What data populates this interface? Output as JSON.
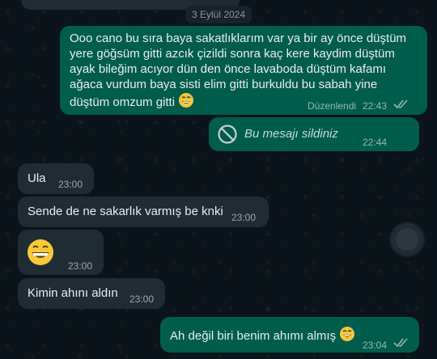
{
  "chat": {
    "date_separator": "3 Eylül 2024",
    "messages": [
      {
        "direction": "outgoing",
        "text": "Ooo cano bu sıra baya sakatlıklarım var ya bir ay önce düştüm yere göğsüm gitti azcık çizildi sonra kaç kere kaydim düştüm ayak bileğim acıyor  dün den önce lavaboda düştüm  kafamı ağaca vurdum baya sisti elim gitti burkuldu bu sabah yine düştüm omzum gitti",
        "edited_label": "Düzenlendi",
        "time": "22:43",
        "status": "read"
      },
      {
        "direction": "outgoing",
        "deleted_text": "Bu mesajı sildiniz",
        "time": "22:44"
      },
      {
        "direction": "incoming",
        "text": "Ula",
        "time": "23:00"
      },
      {
        "direction": "incoming",
        "text": "Sende de ne sakarlık varmış be knki",
        "time": "23:00"
      },
      {
        "direction": "incoming",
        "emoji": "grinning-face-emoji",
        "time": "23:00"
      },
      {
        "direction": "incoming",
        "text": "Kimin ahını aldın",
        "time": "23:00"
      },
      {
        "direction": "outgoing",
        "text": "Ah değil biri benim ahımı almış",
        "time": "23:04",
        "status": "read"
      }
    ]
  },
  "colors": {
    "background": "#0b141a",
    "outgoing_bubble": "#005c4b",
    "incoming_bubble": "#202c33",
    "text": "#e9edef",
    "meta": "#8696a0"
  },
  "icons": [
    "blocked-icon",
    "double-check-icon",
    "sweat-smile-emoji",
    "grinning-face-emoji",
    "scroll-down-button"
  ]
}
